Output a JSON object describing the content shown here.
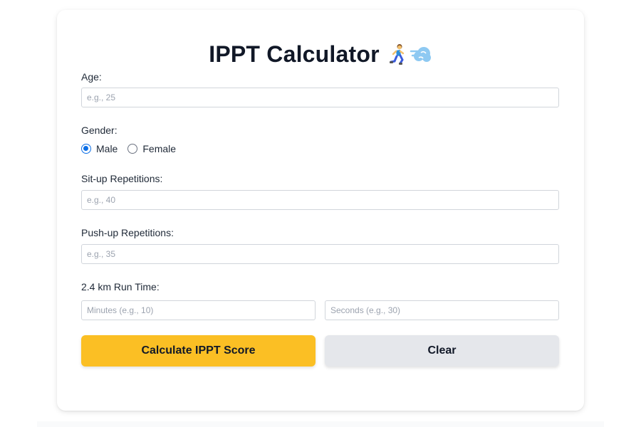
{
  "app": {
    "title": "IPPT Calculator"
  },
  "icons": {
    "runner": "person-running-icon",
    "dash": "dashing-away-icon"
  },
  "colors": {
    "accent": "#fbbf24",
    "secondary": "#e5e7eb",
    "radio_selected": "#0b6ee6"
  },
  "form": {
    "age": {
      "label": "Age:",
      "placeholder": "e.g., 25",
      "value": ""
    },
    "gender": {
      "label": "Gender:",
      "options": [
        {
          "label": "Male",
          "selected": true
        },
        {
          "label": "Female",
          "selected": false
        }
      ]
    },
    "situps": {
      "label": "Sit-up Repetitions:",
      "placeholder": "e.g., 40",
      "value": ""
    },
    "pushups": {
      "label": "Push-up Repetitions:",
      "placeholder": "e.g., 35",
      "value": ""
    },
    "run": {
      "label": "2.4 km Run Time:",
      "minutes_placeholder": "Minutes (e.g., 10)",
      "seconds_placeholder": "Seconds (e.g., 30)"
    }
  },
  "buttons": {
    "calculate_label": "Calculate IPPT Score",
    "clear_label": "Clear"
  }
}
